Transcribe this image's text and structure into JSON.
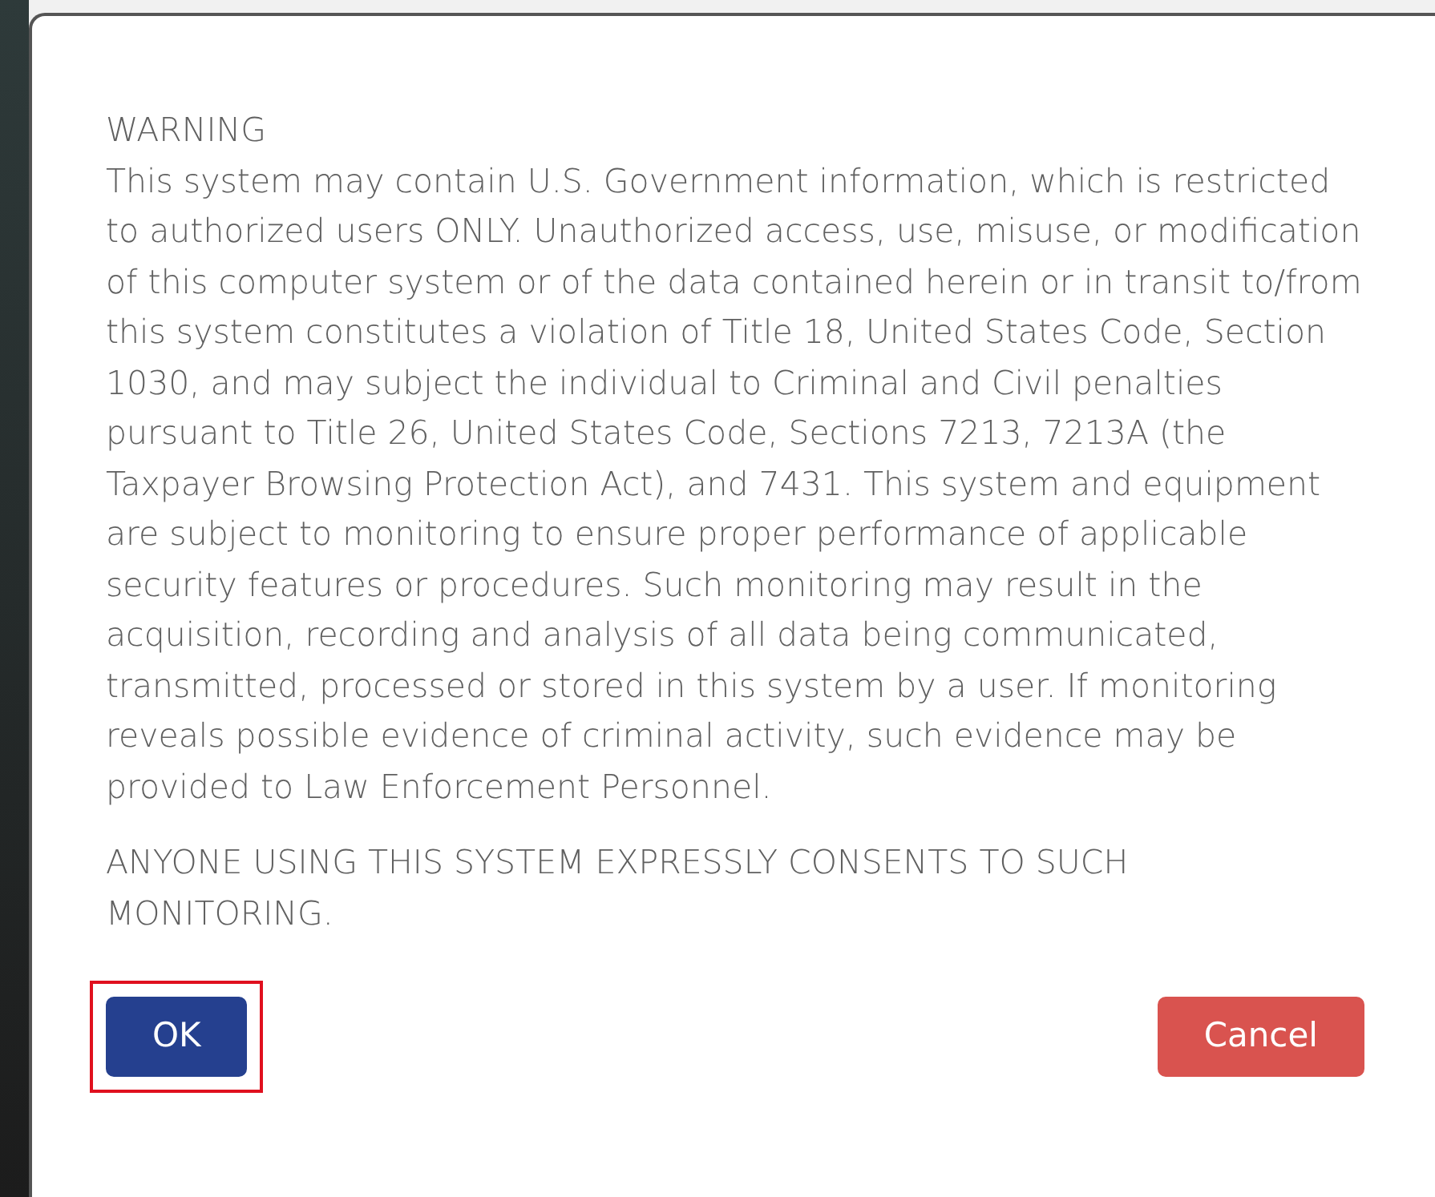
{
  "dialog": {
    "heading": "WARNING",
    "message": "This system may contain U.S. Government information, which is restricted to authorized users ONLY. Unauthorized access, use, misuse, or modification of this computer system or of the data contained herein or in transit to/from this system constitutes a violation of Title 18, United States Code, Section 1030, and may subject the individual to Criminal and Civil penalties pursuant to Title 26, United States Code, Sections 7213, 7213A (the Taxpayer Browsing Protection Act), and 7431. This system and equipment are subject to monitoring to ensure proper performance of applicable security features or procedures. Such monitoring may result in the acquisition, recording and analysis of all data being communicated, transmitted, processed or stored in this system by a user. If monitoring reveals possible evidence of criminal activity, such evidence may be provided to Law Enforcement Personnel.",
    "notice": "ANYONE USING THIS SYSTEM EXPRESSLY CONSENTS TO SUCH MONITORING.",
    "buttons": [
      {
        "label": "OK",
        "kind": "primary",
        "highlighted": true
      },
      {
        "label": "Cancel",
        "kind": "danger",
        "highlighted": false
      }
    ]
  }
}
